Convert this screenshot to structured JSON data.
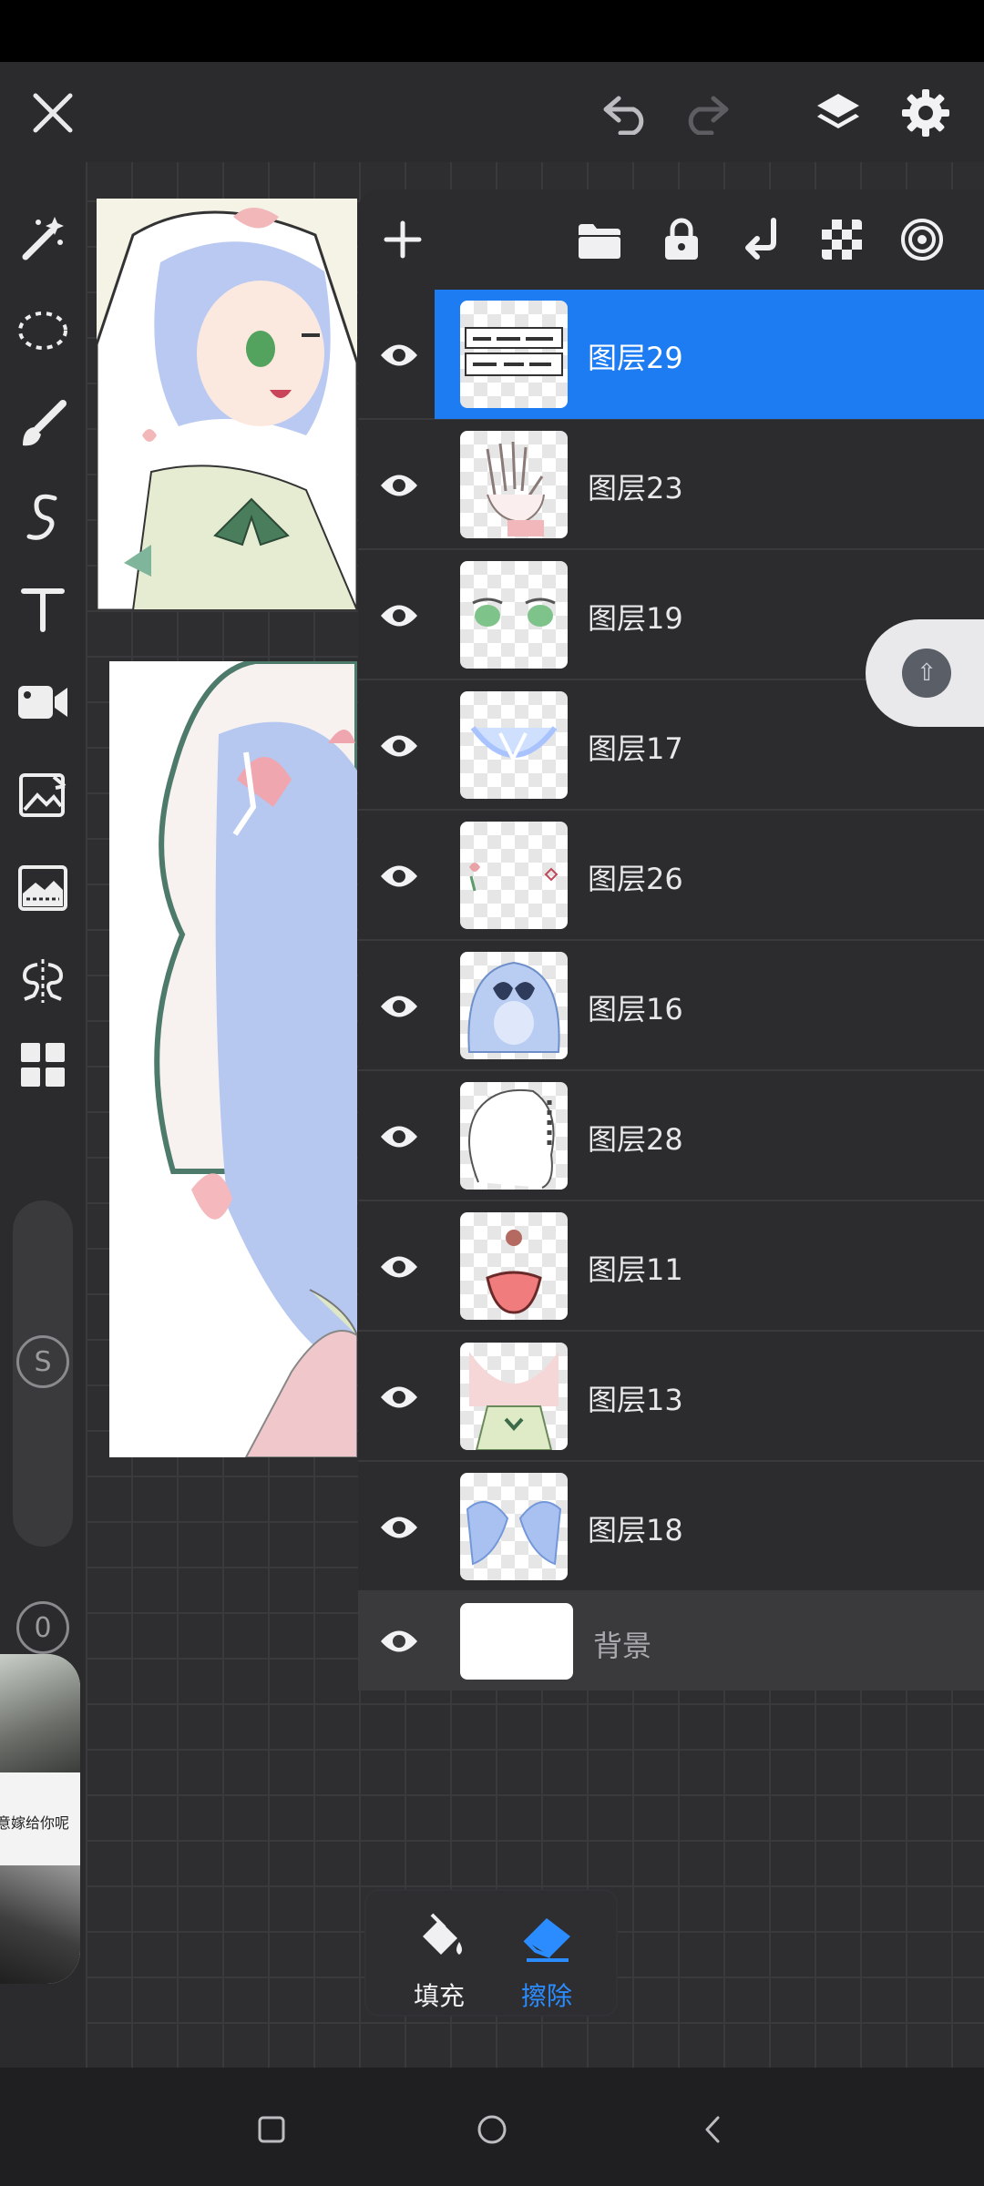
{
  "top_bar": {
    "close_icon": "close-icon",
    "undo_icon": "undo-icon",
    "redo_icon": "redo-icon",
    "layers_icon": "layers-icon",
    "settings_icon": "gear-icon"
  },
  "left_toolbar": {
    "tools": [
      "magic-wand-icon",
      "lasso-select-icon",
      "brush-icon",
      "smudge-icon",
      "text-icon",
      "video-record-icon",
      "image-import-icon",
      "canvas-adjust-icon",
      "symmetry-icon",
      "more-apps-icon"
    ],
    "size_slider_label": "S",
    "opacity_slider_label": "0"
  },
  "layers_panel": {
    "header_icons": [
      "add-layer-icon",
      "folder-icon",
      "lock-icon",
      "merge-down-icon",
      "transparency-checker-icon",
      "blend-target-icon"
    ],
    "layers": [
      {
        "name": "图层29",
        "selected": true
      },
      {
        "name": "图层23",
        "selected": false
      },
      {
        "name": "图层19",
        "selected": false
      },
      {
        "name": "图层17",
        "selected": false
      },
      {
        "name": "图层26",
        "selected": false
      },
      {
        "name": "图层16",
        "selected": false
      },
      {
        "name": "图层28",
        "selected": false
      },
      {
        "name": "图层11",
        "selected": false
      },
      {
        "name": "图层13",
        "selected": false
      },
      {
        "name": "图层18",
        "selected": false
      }
    ],
    "background_layer": {
      "name": "背景"
    }
  },
  "floating_video": {
    "caption": "意嫁给你呢"
  },
  "action_popup": {
    "fill_label": "填充",
    "erase_label": "擦除"
  },
  "colors": {
    "accent": "#1e7cf2",
    "panel_bg": "#2c2c2e",
    "toolbar_bg": "#2b2b2d"
  }
}
